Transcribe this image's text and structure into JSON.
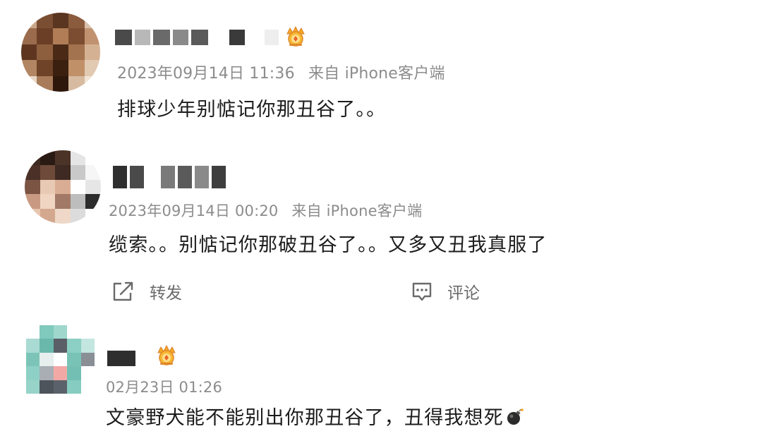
{
  "comments": [
    {
      "time": "2023年09月14日 11:36",
      "source": "来自 iPhone客户端",
      "text": "排球少年别惦记你那丑谷了。。",
      "badge_icon": "crown-badge-icon"
    },
    {
      "time": "2023年09月14日 00:20",
      "source": "来自 iPhone客户端",
      "text": "缆索。。别惦记你那破丑谷了。。又多又丑我真服了",
      "actions": {
        "repost_label": "转发",
        "comment_label": "评论"
      }
    },
    {
      "time": "02月23日 01:26",
      "text": "文豪野犬能不能别出你那丑谷了，丑得我想死",
      "badge_icon": "crown-badge-icon",
      "emoji": "bomb-emoji-icon"
    }
  ],
  "colors": {
    "meta_text": "#8c8c8c",
    "body_text": "#1c1c1c",
    "action_text": "#6a6a6a"
  }
}
